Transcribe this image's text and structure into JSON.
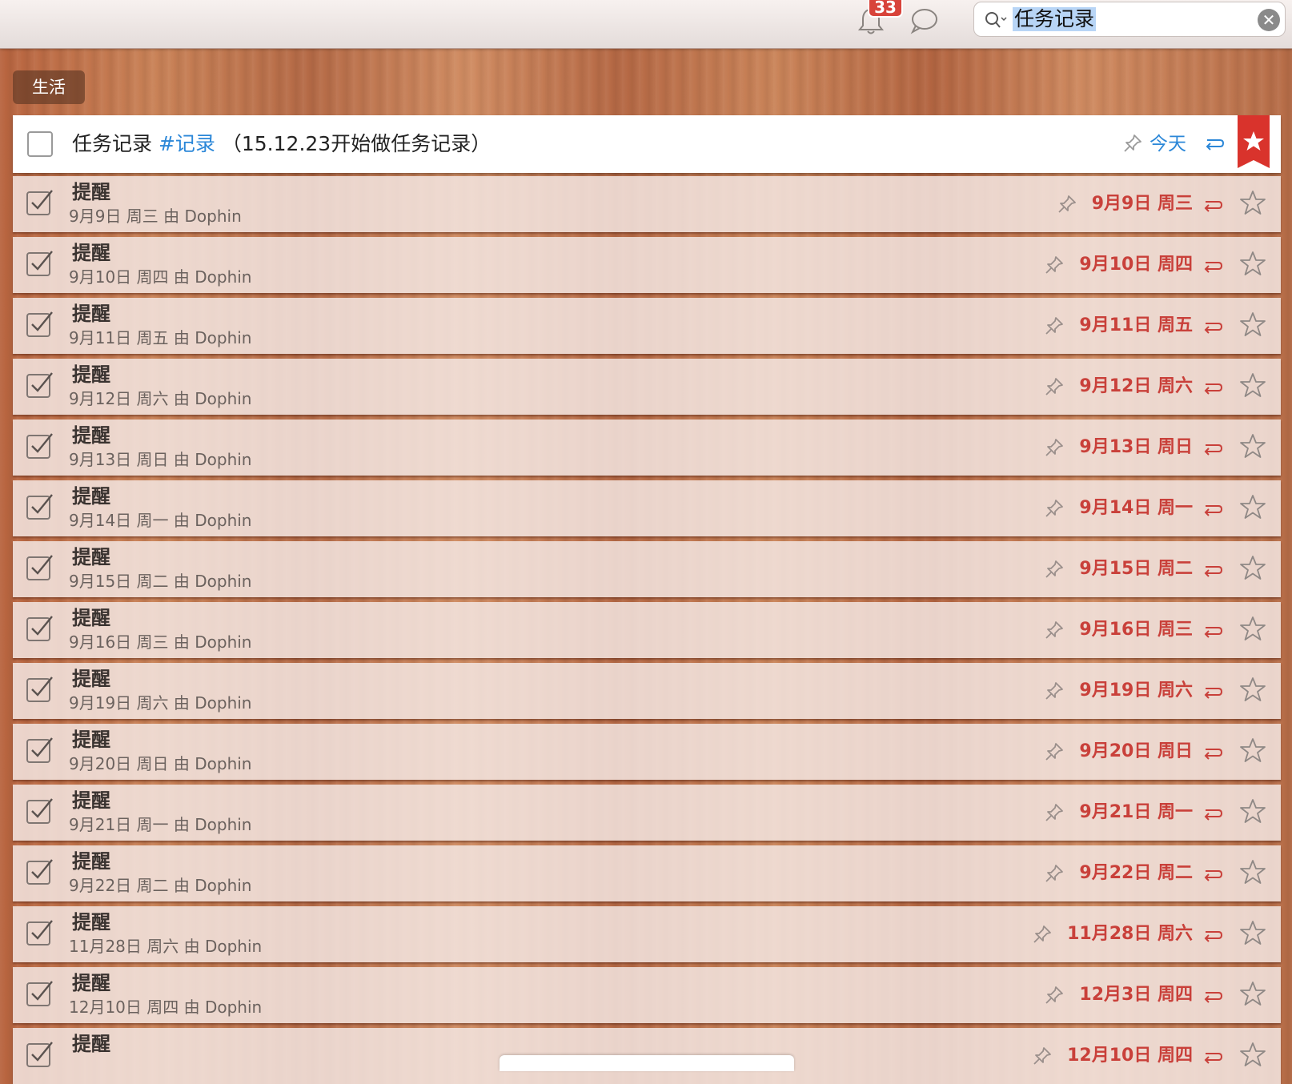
{
  "toolbar": {
    "notification_count": "33",
    "search": {
      "value": "任务记录",
      "clear_label": "✕"
    }
  },
  "list": {
    "name": "生活"
  },
  "header_task": {
    "title": "任务记录",
    "hashtag": "#记录",
    "note": "（15.12.23开始做任务记录）",
    "due": "今天",
    "starred": true
  },
  "tasks": [
    {
      "title": "提醒",
      "meta": "9月9日 周三 由 Dophin",
      "date": "9月9日 周三"
    },
    {
      "title": "提醒",
      "meta": "9月10日 周四 由 Dophin",
      "date": "9月10日 周四"
    },
    {
      "title": "提醒",
      "meta": "9月11日 周五 由 Dophin",
      "date": "9月11日 周五"
    },
    {
      "title": "提醒",
      "meta": "9月12日 周六 由 Dophin",
      "date": "9月12日 周六"
    },
    {
      "title": "提醒",
      "meta": "9月13日 周日 由 Dophin",
      "date": "9月13日 周日"
    },
    {
      "title": "提醒",
      "meta": "9月14日 周一 由 Dophin",
      "date": "9月14日 周一"
    },
    {
      "title": "提醒",
      "meta": "9月15日 周二 由 Dophin",
      "date": "9月15日 周二"
    },
    {
      "title": "提醒",
      "meta": "9月16日 周三 由 Dophin",
      "date": "9月16日 周三"
    },
    {
      "title": "提醒",
      "meta": "9月19日 周六 由 Dophin",
      "date": "9月19日 周六"
    },
    {
      "title": "提醒",
      "meta": "9月20日 周日 由 Dophin",
      "date": "9月20日 周日"
    },
    {
      "title": "提醒",
      "meta": "9月21日 周一 由 Dophin",
      "date": "9月21日 周一"
    },
    {
      "title": "提醒",
      "meta": "9月22日 周二 由 Dophin",
      "date": "9月22日 周二"
    },
    {
      "title": "提醒",
      "meta": "11月28日 周六 由 Dophin",
      "date": "11月28日 周六"
    },
    {
      "title": "提醒",
      "meta": "12月10日 周四 由 Dophin",
      "date": "12月3日 周四"
    },
    {
      "title": "提醒",
      "meta": "",
      "date": "12月10日 周四"
    }
  ]
}
